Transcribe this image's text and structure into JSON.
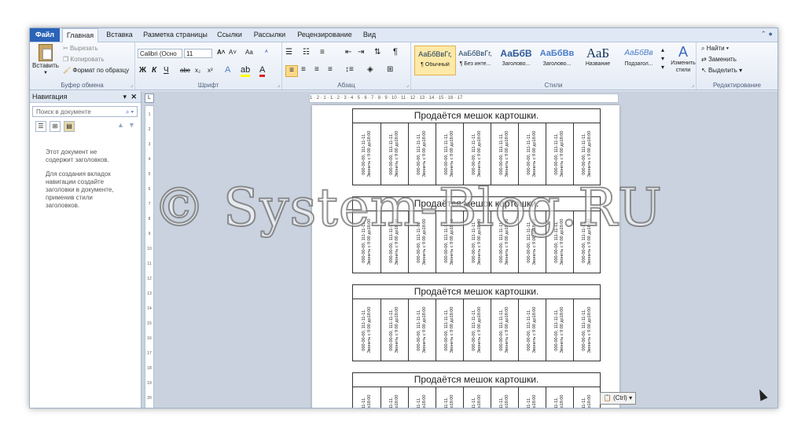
{
  "ribbon_tabs": [
    "Файл",
    "Главная",
    "Вставка",
    "Разметка страницы",
    "Ссылки",
    "Рассылки",
    "Рецензирование",
    "Вид"
  ],
  "clipboard": {
    "paste": "Вставить",
    "cut": "Вырезать",
    "copy": "Копировать",
    "format_painter": "Формат по образцу",
    "label": "Буфер обмена"
  },
  "font": {
    "name": "Calibri (Осно",
    "size": "11",
    "label": "Шрифт",
    "bold": "Ж",
    "italic": "К",
    "underline": "Ч",
    "strike": "abc",
    "sub": "x₂",
    "sup": "x²",
    "grow": "A˄",
    "shrink": "A˅",
    "case": "Aa",
    "clear": "ᴬ"
  },
  "paragraph": {
    "label": "Абзац",
    "pilcrow": "¶"
  },
  "styles": {
    "label": "Стили",
    "items": [
      {
        "sample": "АаБбВвГг,",
        "name": "¶ Обычный"
      },
      {
        "sample": "АаБбВвГг,",
        "name": "¶ Без инте..."
      },
      {
        "sample": "АаБбВ",
        "name": "Заголово..."
      },
      {
        "sample": "АаБбВв",
        "name": "Заголово..."
      },
      {
        "sample": "АаБ",
        "name": "Название"
      },
      {
        "sample": "АаБбВв",
        "name": "Подзагол..."
      }
    ],
    "change": "Изменить стили"
  },
  "editing": {
    "find": "Найти",
    "replace": "Заменить",
    "select": "Выделить",
    "label": "Редактирование"
  },
  "navigation": {
    "title": "Навигация",
    "search_placeholder": "Поиск в документе",
    "msg1": "Этот документ не содержит заголовков.",
    "msg2": "Для создания вкладок навигации создайте заголовки в документе, применив стили заголовков."
  },
  "ruler": {
    "horizontal": "1 · 2 · 1 · 1 · 2 · 3 · 4 · 5 · 6 · 7 · 8 · 9 · 10 · 11 · 12 · 13 · 14 · 15 · 16 · 17",
    "vertical_ticks": [
      "1",
      "2",
      "3",
      "4",
      "5",
      "6",
      "7",
      "8",
      "9",
      "10",
      "11",
      "12",
      "13",
      "14",
      "15",
      "16",
      "17",
      "18",
      "19",
      "20"
    ]
  },
  "document": {
    "flyer_title": "Продаётся мешок картошки.",
    "tear_line1": "000-00-00, 111-11-11.",
    "tear_line2": "Звонить с 9:00 до18:00",
    "flyer_count": 4,
    "strips_per_flyer": 9
  },
  "paste_options": "(Ctrl)",
  "watermark": "© System-Blog.RU"
}
